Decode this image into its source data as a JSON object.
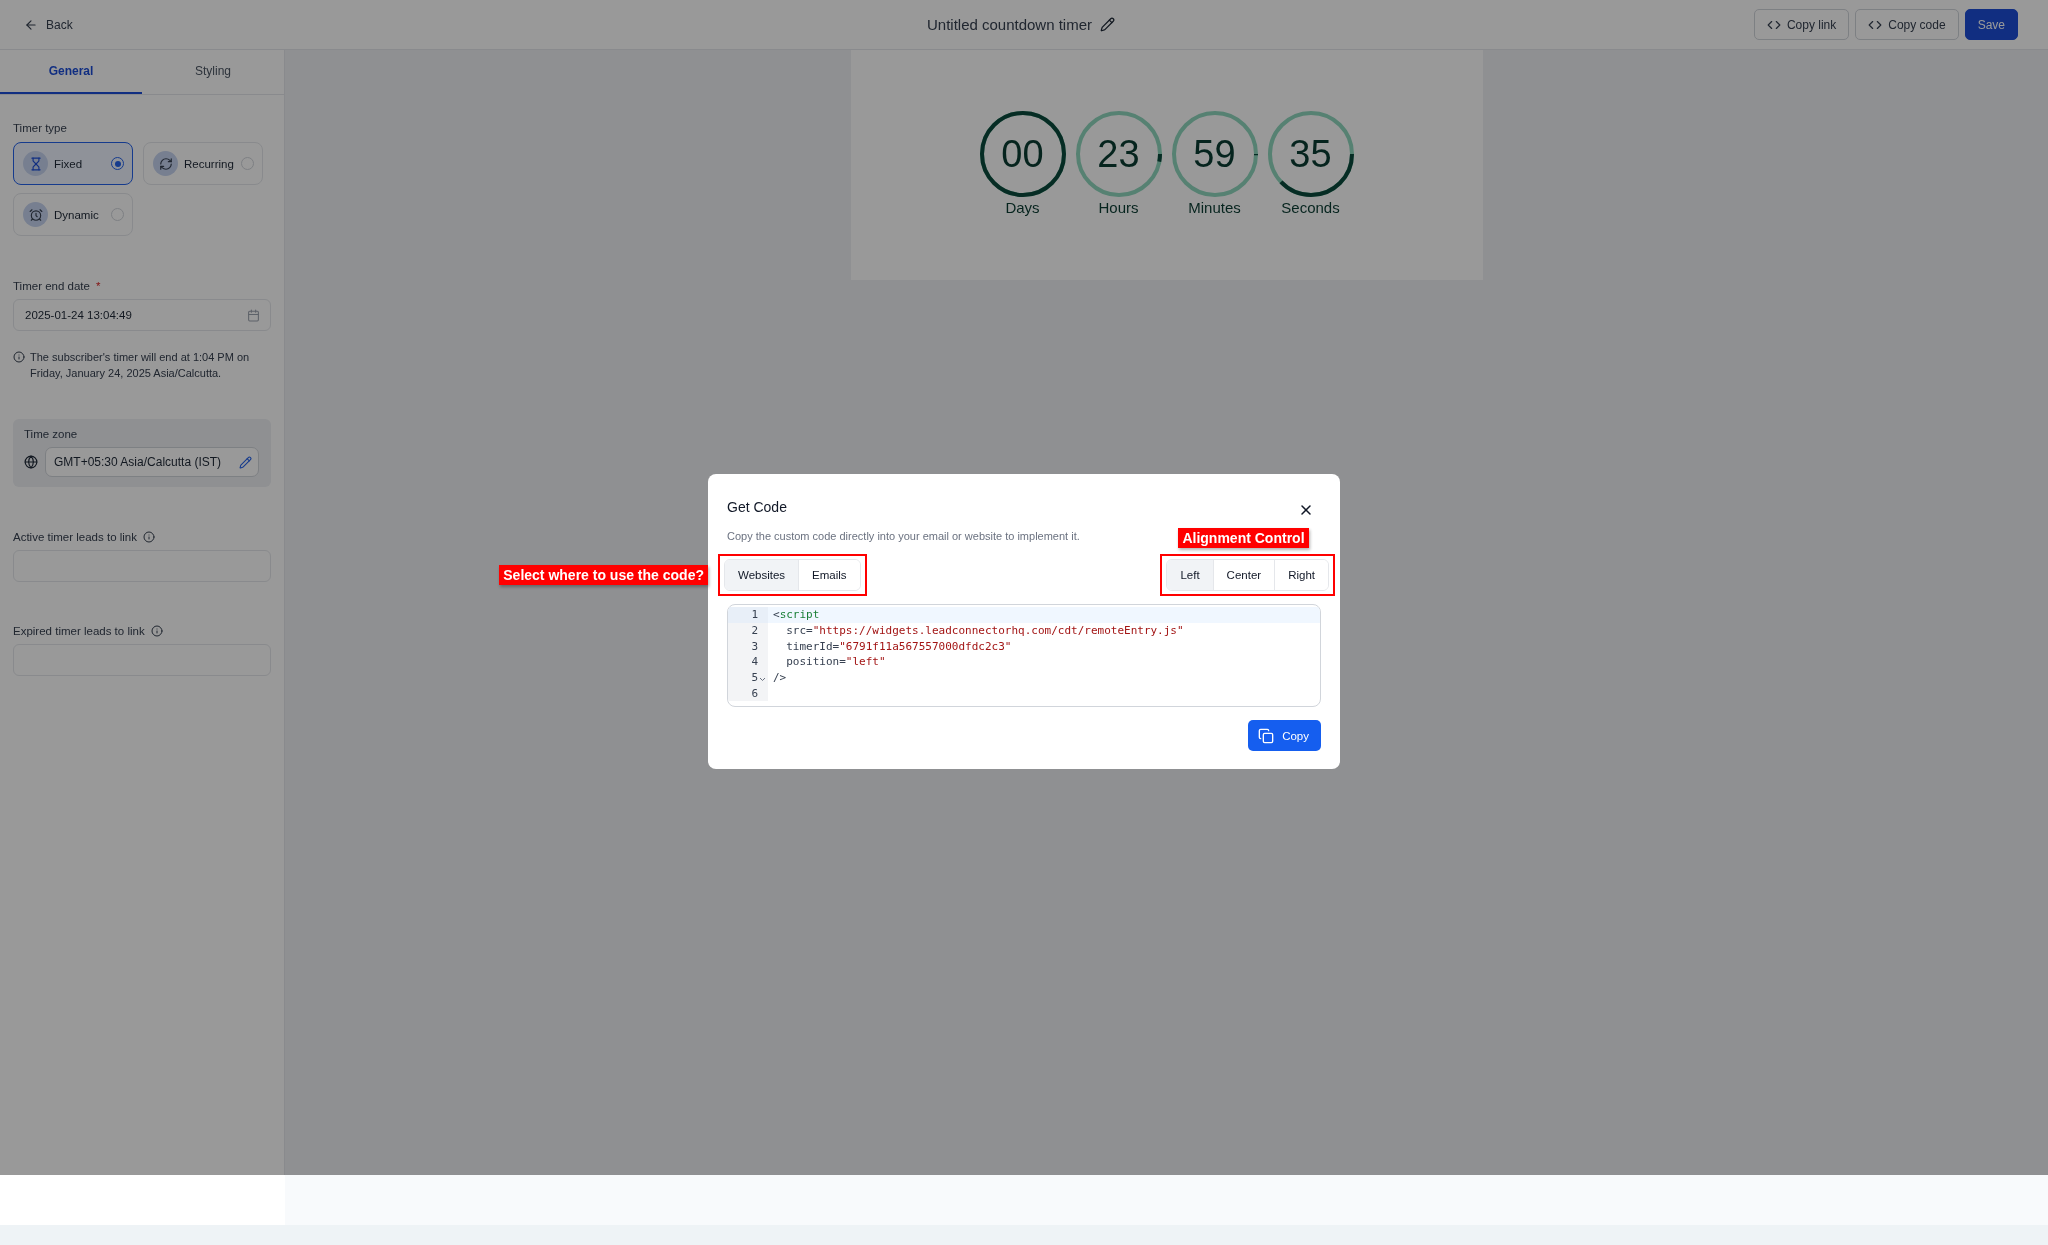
{
  "header": {
    "back": "Back",
    "title": "Untitled countdown timer",
    "buttons": [
      {
        "label": "Copy link",
        "kind": "outline"
      },
      {
        "label": "Copy code",
        "kind": "outline"
      },
      {
        "label": "Save",
        "kind": "primary"
      }
    ]
  },
  "sidebar": {
    "tabs": [
      {
        "label": "General",
        "selected": true
      },
      {
        "label": "Styling",
        "selected": false
      }
    ],
    "timer_type": {
      "label": "Timer type",
      "options": [
        {
          "label": "Fixed",
          "kind": "hourglass",
          "selected": true
        },
        {
          "label": "Recurring",
          "kind": "repeat",
          "selected": false
        },
        {
          "label": "Dynamic",
          "kind": "alarm",
          "selected": false
        }
      ]
    },
    "end_date": {
      "label": "Timer end date",
      "required_mark": "*",
      "value": "2025-01-24 13:04:49"
    },
    "note": "The subscriber's timer will end at 1:04 PM on Friday, January 24, 2025 Asia/Calcutta.",
    "time_zone": {
      "label": "Time zone",
      "value": "GMT+05:30 Asia/Calcutta (IST)"
    },
    "link_fields": [
      {
        "label": "Active timer leads to link"
      },
      {
        "label": "Expired timer leads to link"
      }
    ]
  },
  "preview": {
    "units": [
      {
        "value": "00",
        "label": "Days",
        "level": 1
      },
      {
        "value": "23",
        "label": "Hours",
        "level": 0.03
      },
      {
        "value": "59",
        "label": "Minutes",
        "level": 0.005
      },
      {
        "value": "35",
        "label": "Seconds",
        "level": 0.38
      }
    ]
  },
  "modal": {
    "title": "Get Code",
    "description": "Copy the custom code directly into your email or website to implement it.",
    "platform_tabs": [
      {
        "label": "Websites",
        "selected": true
      },
      {
        "label": "Emails",
        "selected": false
      }
    ],
    "alignment_tabs": [
      {
        "label": "Left",
        "selected": true
      },
      {
        "label": "Center",
        "selected": false
      },
      {
        "label": "Right",
        "selected": false
      }
    ],
    "code_lines": [
      {
        "number": "1",
        "segments": [
          {
            "kind": "plain",
            "text": "<"
          },
          {
            "kind": "tag",
            "text": "script"
          }
        ]
      },
      {
        "number": "2",
        "segments": [
          {
            "kind": "plain",
            "text": "  src="
          },
          {
            "kind": "string",
            "text": "\"https://widgets.leadconnectorhq.com/cdt/remoteEntry.js\""
          }
        ]
      },
      {
        "number": "3",
        "segments": [
          {
            "kind": "plain",
            "text": "  timerId="
          },
          {
            "kind": "string",
            "text": "\"6791f11a567557000dfdc2c3\""
          }
        ]
      },
      {
        "number": "4",
        "segments": [
          {
            "kind": "plain",
            "text": "  position="
          },
          {
            "kind": "string",
            "text": "\"left\""
          }
        ]
      },
      {
        "number": "5",
        "foldable": true,
        "segments": [
          {
            "kind": "plain",
            "text": "/>"
          }
        ]
      },
      {
        "number": "6"
      }
    ],
    "copy_button": "Copy",
    "platform_annotation": "Select where to use the code?",
    "alignment_annotation": "Alignment Control"
  }
}
